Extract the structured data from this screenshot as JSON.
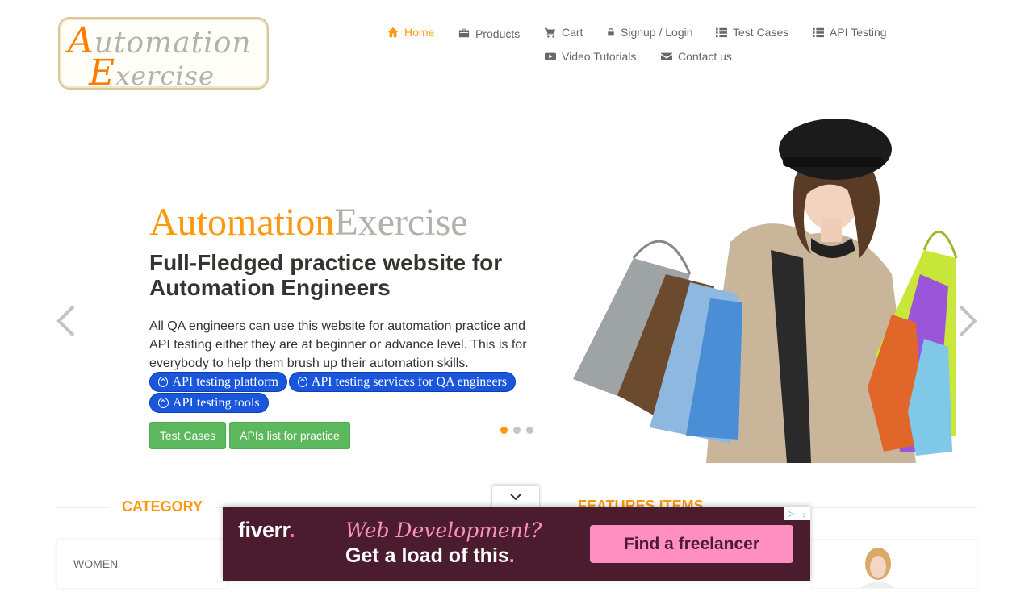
{
  "logo": {
    "line1_cap": "A",
    "line1_rest": "utomation",
    "line2_cap": "E",
    "line2_rest": "xercise"
  },
  "nav": [
    {
      "label": "Home",
      "icon": "home-icon",
      "active": true
    },
    {
      "label": "Products",
      "icon": "briefcase-icon"
    },
    {
      "label": "Cart",
      "icon": "cart-icon"
    },
    {
      "label": "Signup / Login",
      "icon": "lock-icon"
    },
    {
      "label": "Test Cases",
      "icon": "list-icon"
    },
    {
      "label": "API Testing",
      "icon": "list-icon"
    },
    {
      "label": "Video Tutorials",
      "icon": "youtube-icon"
    },
    {
      "label": "Contact us",
      "icon": "envelope-icon"
    }
  ],
  "slider": {
    "title_orange": "Automation",
    "title_gray": "Exercise",
    "subtitle": "Full-Fledged practice website for Automation Engineers",
    "description": "All QA engineers can use this website for automation practice and API testing either they are at beginner or advance level. This is for everybody to help them brush up their automation skills.",
    "ad_links": [
      "API testing platform",
      "API testing services for QA engineers",
      "API testing tools"
    ],
    "buttons": {
      "test_cases": "Test Cases",
      "apis_list": "APIs list for practice"
    },
    "active_slide": 1,
    "slide_count": 3
  },
  "sections": {
    "category": "CATEGORY",
    "features": "FEATURES ITEMS"
  },
  "categories": [
    "WOMEN"
  ],
  "ad": {
    "brand": "fiverr",
    "brand_dot": ".",
    "headline": "Web Development?",
    "tagline": "Get a load of this",
    "tagline_dot": ".",
    "cta": "Find a freelancer"
  },
  "colors": {
    "accent": "#fe980f",
    "button_green": "#5cb85c",
    "ad_bg": "#4a1c2e",
    "ad_pink": "#ff8fc0",
    "pill_blue": "#1a56db"
  }
}
